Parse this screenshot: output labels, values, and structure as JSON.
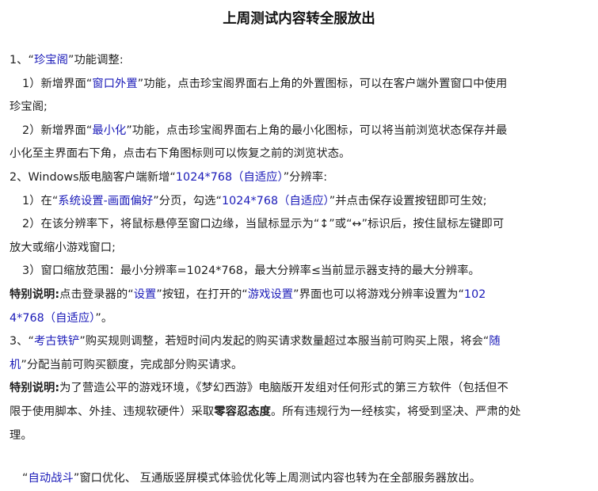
{
  "title": "上周测试内容转全服放出",
  "s1": {
    "head": [
      "1、“",
      "珍宝阁",
      "”功能调整:"
    ],
    "p1": [
      "1）新增界面“",
      "窗口外置",
      "”功能，点击珍宝阁界面右上角的外置图标，可以在客户端外置窗口中使用",
      "珍宝阁;"
    ],
    "p2": [
      "2）新增界面“",
      "最小化",
      "”功能，点击珍宝阁界面右上角的最小化图标，可以将当前浏览状态保存并最",
      "小化至主界面右下角，点击右下角图标则可以恢复之前的浏览状态。"
    ]
  },
  "s2": {
    "head": [
      "2、Windows版电脑客户端新增“",
      "1024*768（自适应）",
      "”分辨率:"
    ],
    "p1": [
      "1）在“",
      "系统设置-画面偏好",
      "”分页，勾选“",
      "1024*768（自适应）",
      "”并点击保存设置按钮即可生效;"
    ],
    "p2": [
      "2）在该分辨率下，将鼠标悬停至窗口边缘，当鼠标显示为“↕”或“↔”标识后，按住鼠标左键即可",
      "放大或缩小游戏窗口;"
    ],
    "p3": "3）窗口缩放范围：最小分辨率=1024*768，最大分辨率≤当前显示器支持的最大分辨率。",
    "note": [
      "特别说明:",
      "点击登录器的“",
      "设置",
      "”按钮，在打开的“",
      "游戏设置",
      "”界面也可以将游戏分辨率设置为“",
      "102",
      "4*768（自适应）",
      "”。"
    ]
  },
  "s3": {
    "head": [
      "3、“",
      "考古铁铲",
      "”购买规则调整，若短时间内发起的购买请求数量超过本服当前可购买上限，将会“",
      "随",
      "机",
      "”分配当前可购买额度，完成部分购买请求。"
    ],
    "note": [
      "特别说明:",
      "为了营造公平的游戏环境，《梦幻西游》电脑版开发组对任何形式的第三方软件（包括但不",
      "限于使用脚本、外挂、违规软硬件）采取",
      "零容忍态度",
      "。所有违规行为一经核实，将受到坚决、严肃的处",
      "理。"
    ]
  },
  "footer": [
    "“",
    "自动战斗",
    "”窗口优化、 互通版竖屏模式体验优化等上周测试内容也转为在全部服务器放出。"
  ]
}
